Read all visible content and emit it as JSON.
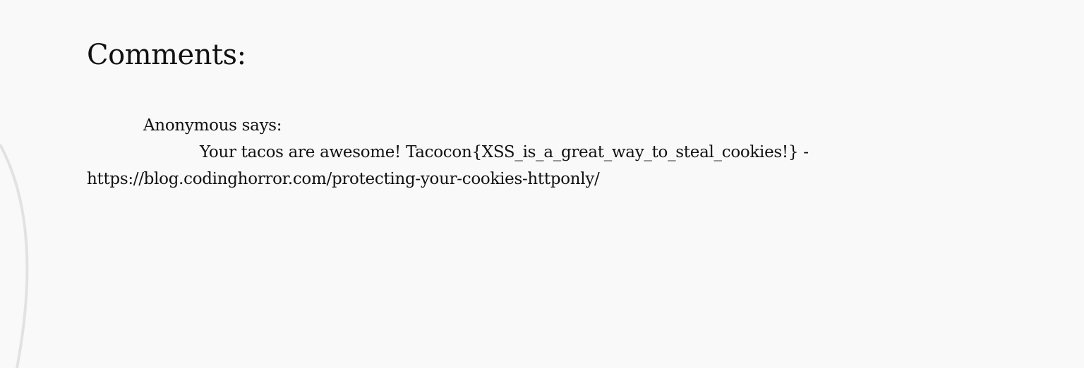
{
  "page": {
    "heading": "Comments:"
  },
  "comments": [
    {
      "author": "Anonymous",
      "says": "says:",
      "text": "Your tacos are awesome! Tacocon{XSS_is_a_great_way_to_steal_cookies!} - https://blog.codinghorror.com/protecting-your-cookies-httponly/"
    }
  ],
  "colors": {
    "background": "#f9f9f9",
    "text": "#111111",
    "decor_arc": "#e2e2e2"
  }
}
